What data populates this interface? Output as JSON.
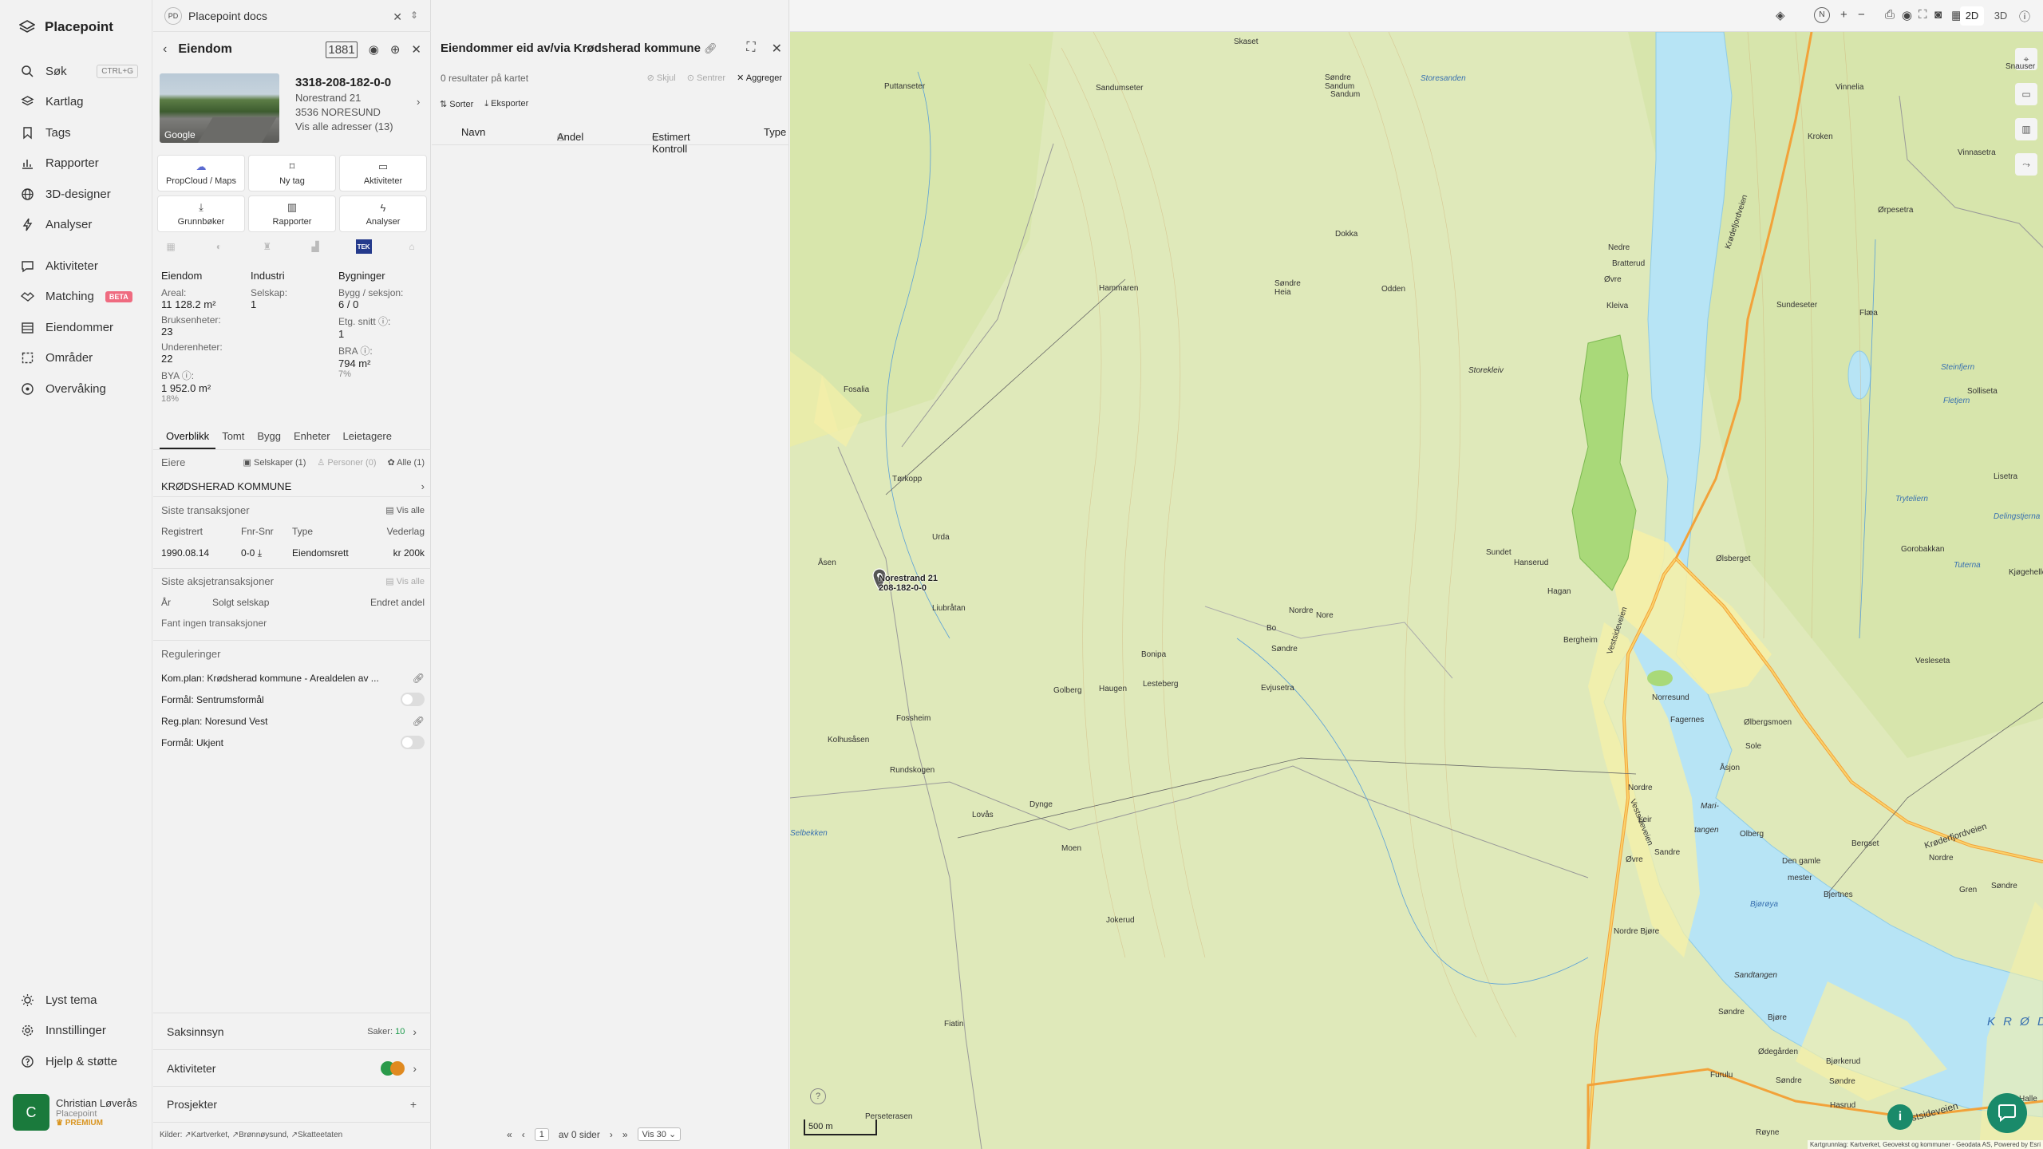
{
  "app": {
    "name": "Placepoint"
  },
  "nav": {
    "items": [
      {
        "label": "Søk",
        "shortcut": "CTRL+G"
      },
      {
        "label": "Kartlag"
      },
      {
        "label": "Tags"
      },
      {
        "label": "Rapporter"
      },
      {
        "label": "3D-designer"
      },
      {
        "label": "Analyser"
      }
    ],
    "items2": [
      {
        "label": "Aktiviteter"
      },
      {
        "label": "Matching",
        "badge": "BETA"
      },
      {
        "label": "Eiendommer"
      },
      {
        "label": "Områder"
      },
      {
        "label": "Overvåking"
      }
    ],
    "bottom": [
      {
        "label": "Lyst tema"
      },
      {
        "label": "Innstillinger"
      },
      {
        "label": "Hjelp & støtte"
      }
    ],
    "user": {
      "initial": "C",
      "name": "Christian Løverås",
      "org": "Placepoint",
      "plan": "PREMIUM"
    }
  },
  "docs": {
    "badge": "PD",
    "title": "Placepoint docs"
  },
  "property": {
    "title": "Eiendom",
    "badge": "1881",
    "gnr": "3318-208-182-0-0",
    "street": "Norestrand 21",
    "postal": "3536 NORESUND",
    "all_addresses": "Vis alle adresser (13)",
    "photo_credit": "Google",
    "tiles_row1": [
      "PropCloud / Maps",
      "Ny tag",
      "Aktiviteter"
    ],
    "tiles_row2": [
      "Grunnbøker",
      "Rapporter",
      "Analyser"
    ],
    "source_tek": "TEK",
    "stats": {
      "col1": {
        "heading": "Eiendom",
        "areal_label": "Areal:",
        "areal_value": "11 128.2 m²",
        "bruks_label": "Bruksenheter:",
        "bruks_value": "23",
        "under_label": "Underenheter:",
        "under_value": "22",
        "bya_label": "BYA ⓘ:",
        "bya_value": "1 952.0 m²",
        "bya_pct": "18%"
      },
      "col2": {
        "heading": "Industri",
        "selskap_label": "Selskap:",
        "selskap_value": "1"
      },
      "col3": {
        "heading": "Bygninger",
        "bygg_label": "Bygg / seksjon:",
        "bygg_value": "6 / 0",
        "etg_label": "Etg. snitt ⓘ:",
        "etg_value": "1",
        "bra_label": "BRA ⓘ:",
        "bra_value": "794 m²",
        "bra_pct": "7%"
      }
    },
    "tabs": [
      "Overblikk",
      "Tomt",
      "Bygg",
      "Enheter",
      "Leietagere"
    ],
    "owners": {
      "label": "Eiere",
      "filters": [
        "Selskaper (1)",
        "Personer (0)",
        "Alle (1)"
      ],
      "owner": "KRØDSHERAD KOMMUNE"
    },
    "transactions": {
      "label": "Siste transaksjoner",
      "show_all": "Vis alle",
      "headers": [
        "Registrert",
        "Fnr-Snr",
        "Type",
        "Vederlag"
      ],
      "row": [
        "1990.08.14",
        "0-0",
        "Eiendomsrett",
        "kr 200k"
      ]
    },
    "share_transactions": {
      "label": "Siste aksjetransaksjoner",
      "show_all": "Vis alle",
      "headers": [
        "År",
        "Solgt selskap",
        "Endret andel"
      ],
      "empty": "Fant ingen transaksjoner"
    },
    "regulations": {
      "label": "Reguleringer",
      "items": [
        "Kom.plan: Krødsherad kommune - Arealdelen av ...",
        "Formål: Sentrumsformål",
        "Reg.plan: Noresund Vest",
        "Formål: Ukjent"
      ]
    },
    "saksinnsyn": {
      "label": "Saksinnsyn",
      "cases_label": "Saker:",
      "cases_count": "10"
    },
    "aktiviteter": {
      "label": "Aktiviteter"
    },
    "prosjekter": {
      "label": "Prosjekter",
      "add": "+"
    },
    "kilder": {
      "label": "Kilder:",
      "sources": [
        "Kartverket,",
        "Brønnøysund,",
        "Skatteetaten"
      ]
    }
  },
  "results": {
    "title": "Eiendommer eid av/via Krødsherad kommune",
    "count": "0 resultater på kartet",
    "actions": [
      "Skjul",
      "Sentrer",
      "Aggreger"
    ],
    "sort": "Sorter",
    "export": "Eksporter",
    "columns": [
      "Navn",
      "Andel",
      "Estimert Kontroll",
      "Type"
    ],
    "pager": {
      "page": "1",
      "of": "av 0 sider",
      "per_page": "Vis 30"
    }
  },
  "map": {
    "mode_2d": "2D",
    "mode_3d": "3D",
    "north": "N",
    "scale": "500 m",
    "pin_label_line1": "Norestrand 21",
    "pin_label_line2": "208-182-0-0",
    "attribution": "Kartgrunnlag: Kartverket, Geovekst og kommuner - Geodata AS, Powered by Esri",
    "colors": {
      "land": "#dfe9ba",
      "water": "#b7e4f5",
      "forest": "#a9d979",
      "urban": "#f5f0a8",
      "accent": "#1a8a6a"
    },
    "place_labels": [
      "Skaset",
      "Sandumseter",
      "Puttanseter",
      "Søndre Sandum",
      "Storesanden",
      "Sandum",
      "Vinnelia",
      "Vinnasetra",
      "Kroken",
      "Hammaren",
      "Dokka",
      "Nedre",
      "Øvre",
      "Odden",
      "Bratterud",
      "Kleiva",
      "Søndre Heia",
      "Sundeseter",
      "Flæa",
      "Storekleiv",
      "Fosalia",
      "Solliseta",
      "Tørkopp",
      "Urda",
      "Åsen",
      "Sundet",
      "Hanserud",
      "Hagan",
      "Bergheim",
      "Liubråtan",
      "Nordre",
      "Nore",
      "Bo",
      "Søndre",
      "Bonipa",
      "Evjusetra",
      "Haugen",
      "Golberg",
      "Lesteberg",
      "Norresund",
      "Fagernes",
      "Ølbergsmoen",
      "Sole",
      "Vesleseta",
      "Fossheim",
      "Kolhusåsen",
      "Rundskogen",
      "Åsjon",
      "Lovås",
      "Dynge",
      "Nordre",
      "Mari-",
      "tangen",
      "Olberg",
      "Moen",
      "Leir",
      "Sandre",
      "Øvre",
      "Den gamle",
      "mester",
      "Bjertnes",
      "Bergset",
      "Nordre",
      "Gren",
      "Søndre",
      "Jokerud",
      "Nordre Bjøre",
      "Sandtangen",
      "Søndre",
      "Bjøre",
      "Fiatin",
      "Ødegården",
      "Bjørkerud",
      "Søndre",
      "Søndre",
      "Furulu",
      "Perseterasen",
      "Røyne",
      "Hasrud",
      "Halle",
      "Snauser",
      "Ørpesetra",
      "Gorobakkan",
      "Lisetra",
      "Tryteliern",
      "Steinfjern",
      "Fletjern",
      "Tuterna",
      "Delingstjerna",
      "Kjøgeheller",
      "Selbekken",
      "Bjørøya",
      "Ølsberget"
    ],
    "road_labels": [
      "Krødefjordveien",
      "Vestsideveien",
      "Vestsideveien",
      "Vestsideveien",
      "Krøderfjordveien"
    ],
    "lake_label": "K R Ø D"
  }
}
